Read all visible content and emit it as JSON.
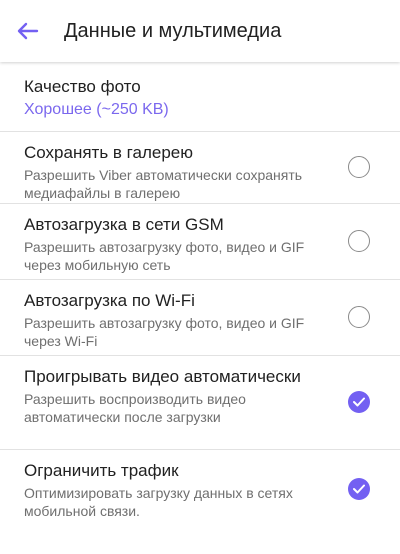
{
  "header": {
    "title": "Данные и мультимедиа",
    "back_icon": "arrow-left-icon"
  },
  "colors": {
    "accent": "#7360f2",
    "accent_text": "#7b68ee",
    "primary_text": "#212121",
    "secondary_text": "#6f6f6f",
    "divider": "#e2e2e2"
  },
  "settings": {
    "photo_quality": {
      "label": "Качество фото",
      "value": "Хорошее (~250 KB)"
    },
    "save_to_gallery": {
      "label": "Сохранять в галерею",
      "description": "Разрешить Viber автоматически сохранять медиафайлы в галерею",
      "checked": false
    },
    "autoload_gsm": {
      "label": "Автозагрузка в сети GSM",
      "description": "Разрешить автозагрузку фото, видео и GIF через мобильную сеть",
      "checked": false
    },
    "autoload_wifi": {
      "label": "Автозагрузка по Wi-Fi",
      "description": "Разрешить автозагрузку фото, видео и GIF через Wi-Fi",
      "checked": false
    },
    "autoplay_video": {
      "label": "Проигрывать видео автоматически",
      "description": "Разрешить воспроизводить видео автоматически после загрузки",
      "checked": true
    },
    "limit_traffic": {
      "label": "Ограничить трафик",
      "description": "Оптимизировать загрузку данных в сетях мобильной связи.",
      "checked": true
    }
  }
}
